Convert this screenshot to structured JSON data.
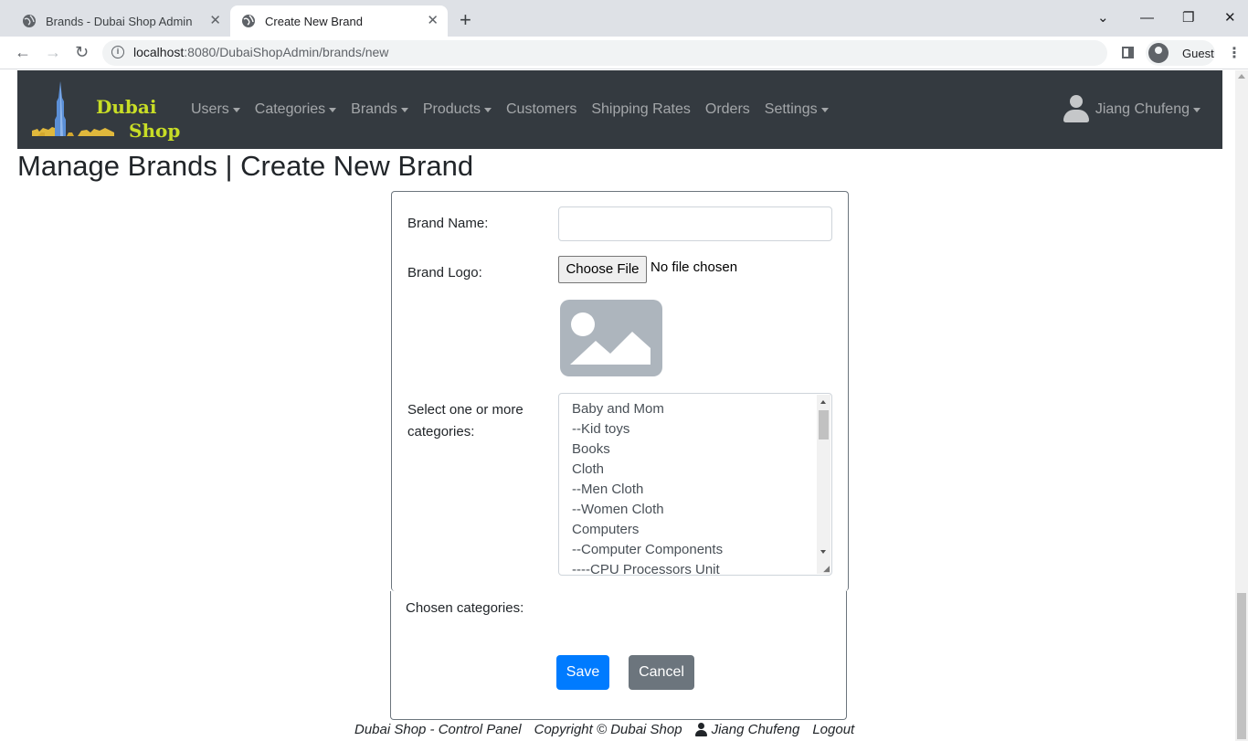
{
  "browser": {
    "tabs": [
      {
        "label": "Brands - Dubai Shop Admin",
        "active": false
      },
      {
        "label": "Create New Brand",
        "active": true
      }
    ],
    "url_host": "localhost",
    "url_rest": ":8080/DubaiShopAdmin/brands/new",
    "profile": "Guest"
  },
  "navbar": {
    "logo_line1": "Dubai",
    "logo_line2": "Shop",
    "items": [
      {
        "label": "Users",
        "dropdown": true
      },
      {
        "label": "Categories",
        "dropdown": true
      },
      {
        "label": "Brands",
        "dropdown": true
      },
      {
        "label": "Products",
        "dropdown": true
      },
      {
        "label": "Customers",
        "dropdown": false
      },
      {
        "label": "Shipping Rates",
        "dropdown": false
      },
      {
        "label": "Orders",
        "dropdown": false
      },
      {
        "label": "Settings",
        "dropdown": true
      }
    ],
    "user_name": "Jiang Chufeng"
  },
  "page": {
    "title": "Manage Brands | Create New Brand"
  },
  "form": {
    "brand_name_label": "Brand Name:",
    "brand_name_value": "",
    "brand_logo_label": "Brand Logo:",
    "choose_file_label": "Choose File",
    "file_status": "No file chosen",
    "categories_label_line1": "Select one or more",
    "categories_label_line2": "categories:",
    "categories": [
      "Baby and Mom",
      "--Kid toys",
      "Books",
      "Cloth",
      "--Men Cloth",
      "--Women Cloth",
      "Computers",
      "--Computer Components",
      "----CPU Processors Unit"
    ],
    "chosen_label": "Chosen categories:",
    "save_label": "Save",
    "cancel_label": "Cancel"
  },
  "footer": {
    "app": "Dubai Shop - Control Panel",
    "copyright": "Copyright © Dubai Shop",
    "user": "Jiang Chufeng",
    "logout": "Logout"
  },
  "colors": {
    "navbar_bg": "#343a40",
    "primary": "#007bff",
    "secondary": "#6c757d",
    "logo_text": "#c8dd26"
  }
}
